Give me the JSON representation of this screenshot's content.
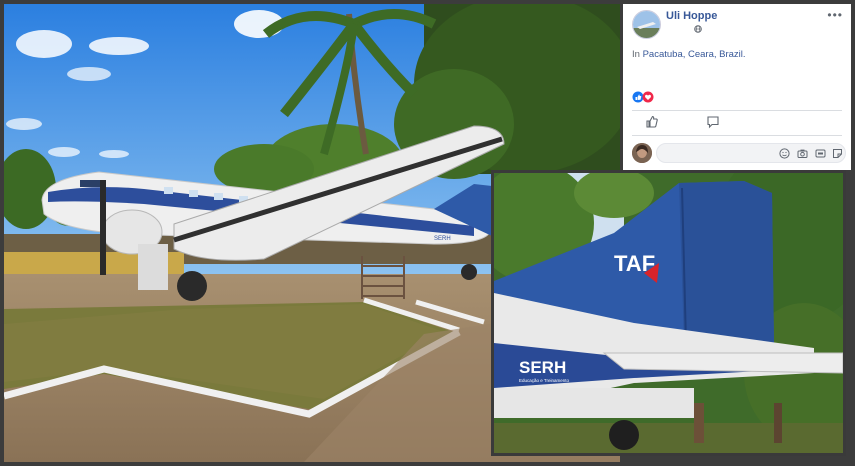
{
  "post": {
    "author": "Uli Hoppe",
    "more_label": "•••",
    "location_prefix": "In",
    "location": "Pacatuba, Ceara, Brazil."
  },
  "photo_main": {
    "fuselage_logo": "SERH"
  },
  "photo_inset": {
    "tail_logo": "TAF",
    "fuselage_logo": "SERH",
    "fuselage_subtext": "Educação e Treinamento"
  },
  "icons": {
    "globe": "globe-icon",
    "like": "like-icon",
    "love": "love-icon",
    "thumb": "thumbs-up-icon",
    "comment": "comment-icon",
    "emoji": "emoji-icon",
    "camera": "camera-icon",
    "gif": "gif-icon",
    "sticker": "sticker-icon"
  },
  "colors": {
    "link": "#385898",
    "sky": "#2f86e0",
    "tail_blue": "#2e5aa8",
    "fuselage_white": "#eeeeee",
    "fb_like_blue": "#1877f2",
    "fb_love_red": "#f0284a"
  }
}
